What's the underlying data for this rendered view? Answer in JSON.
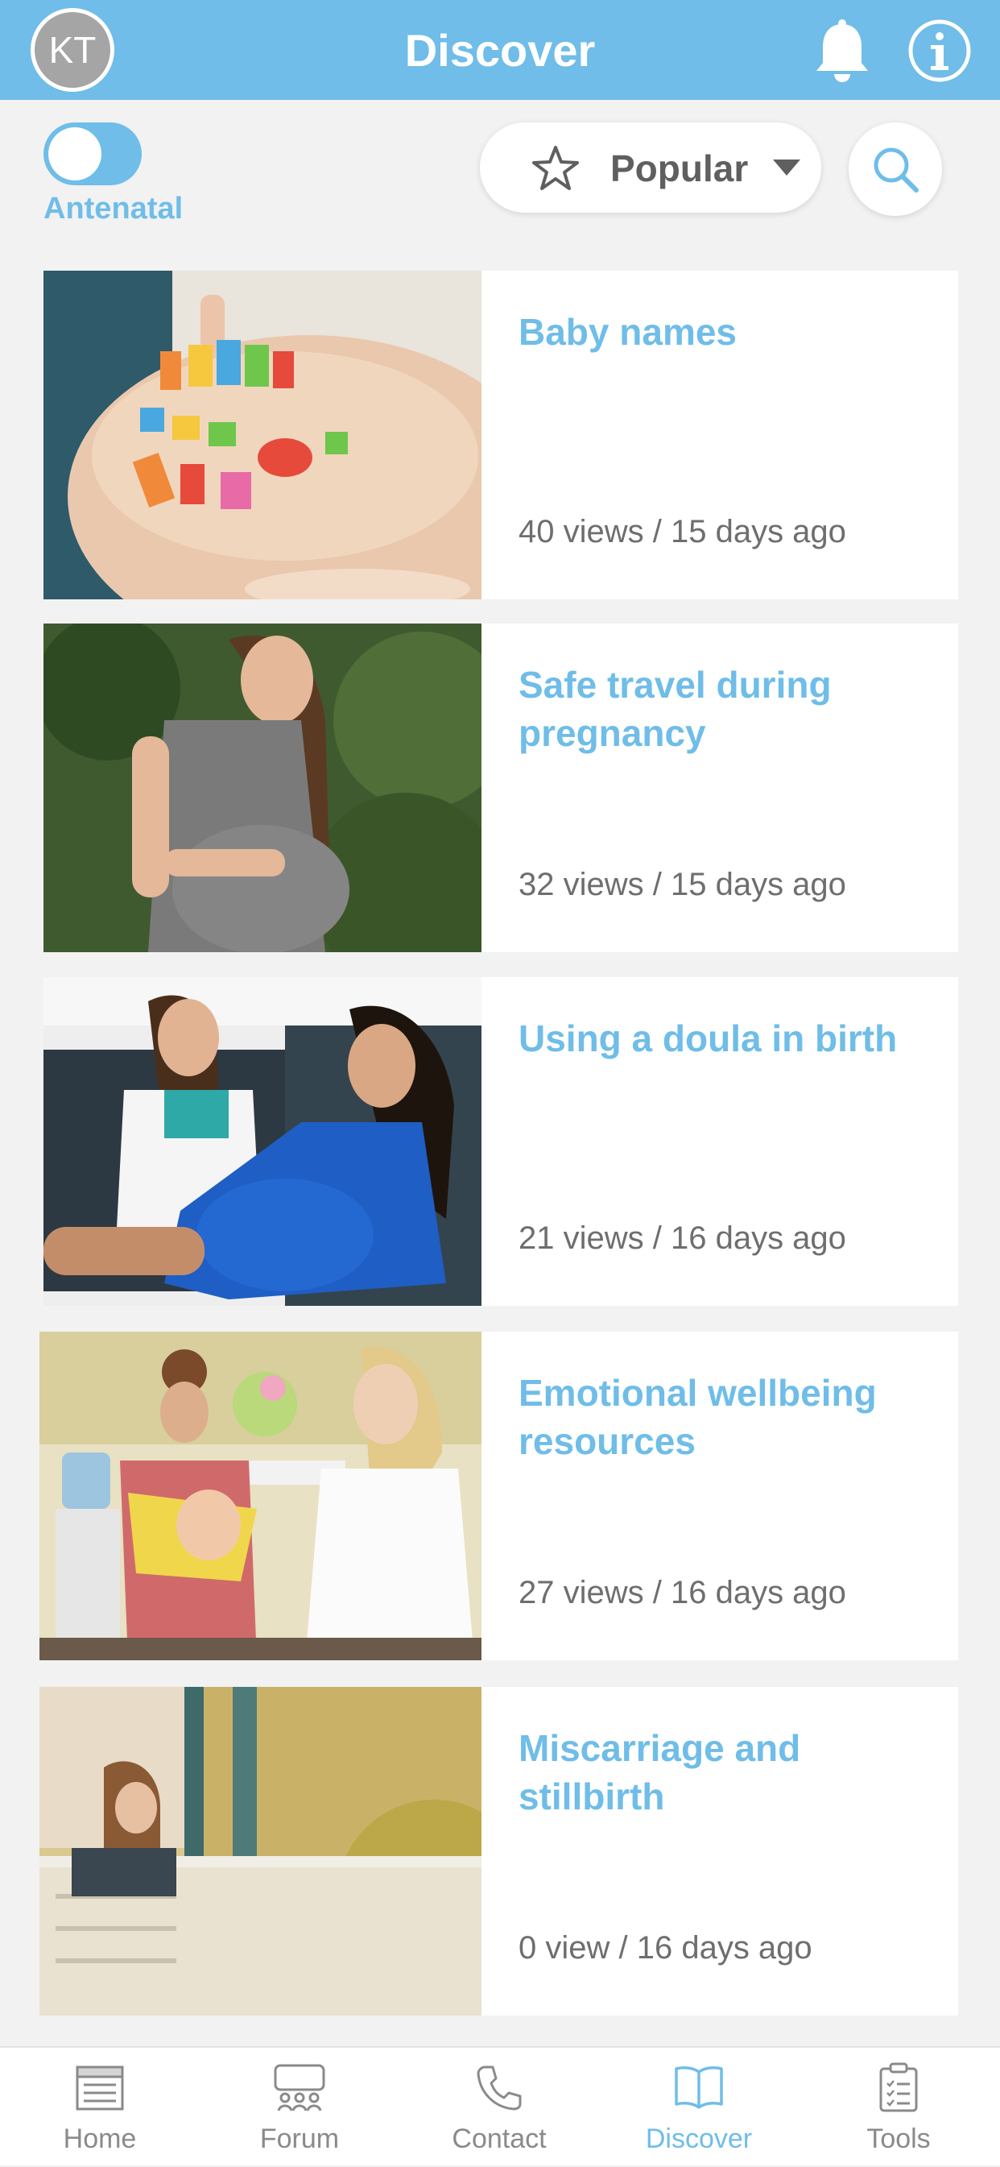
{
  "header": {
    "avatar_initials": "KT",
    "title": "Discover",
    "icons": [
      "bell-icon",
      "info-icon"
    ]
  },
  "filter": {
    "toggle_on": true,
    "toggle_label": "Antenatal",
    "sort_label": "Popular",
    "sort_icon": "star-icon",
    "search_icon": "search-icon"
  },
  "articles": [
    {
      "title": "Baby names",
      "meta": "40 views / 15 days ago"
    },
    {
      "title": "Safe travel during pregnancy",
      "meta": "32 views / 15 days ago"
    },
    {
      "title": "Using a doula in birth",
      "meta": "21 views / 16 days ago"
    },
    {
      "title": "Emotional wellbeing resources",
      "meta": "27 views / 16 days ago"
    },
    {
      "title": "Miscarriage and stillbirth",
      "meta": "0 view / 16 days ago"
    }
  ],
  "tabs": [
    {
      "label": "Home",
      "icon": "newspaper-icon"
    },
    {
      "label": "Forum",
      "icon": "chat-group-icon"
    },
    {
      "label": "Contact",
      "icon": "phone-icon"
    },
    {
      "label": "Discover",
      "icon": "open-book-icon",
      "active": true
    },
    {
      "label": "Tools",
      "icon": "clipboard-icon"
    }
  ],
  "colors": {
    "accent": "#6fbde8",
    "background": "#f2f2f2",
    "meta_text": "#6e6e6e",
    "inactive_tab": "#8a8a8a"
  }
}
